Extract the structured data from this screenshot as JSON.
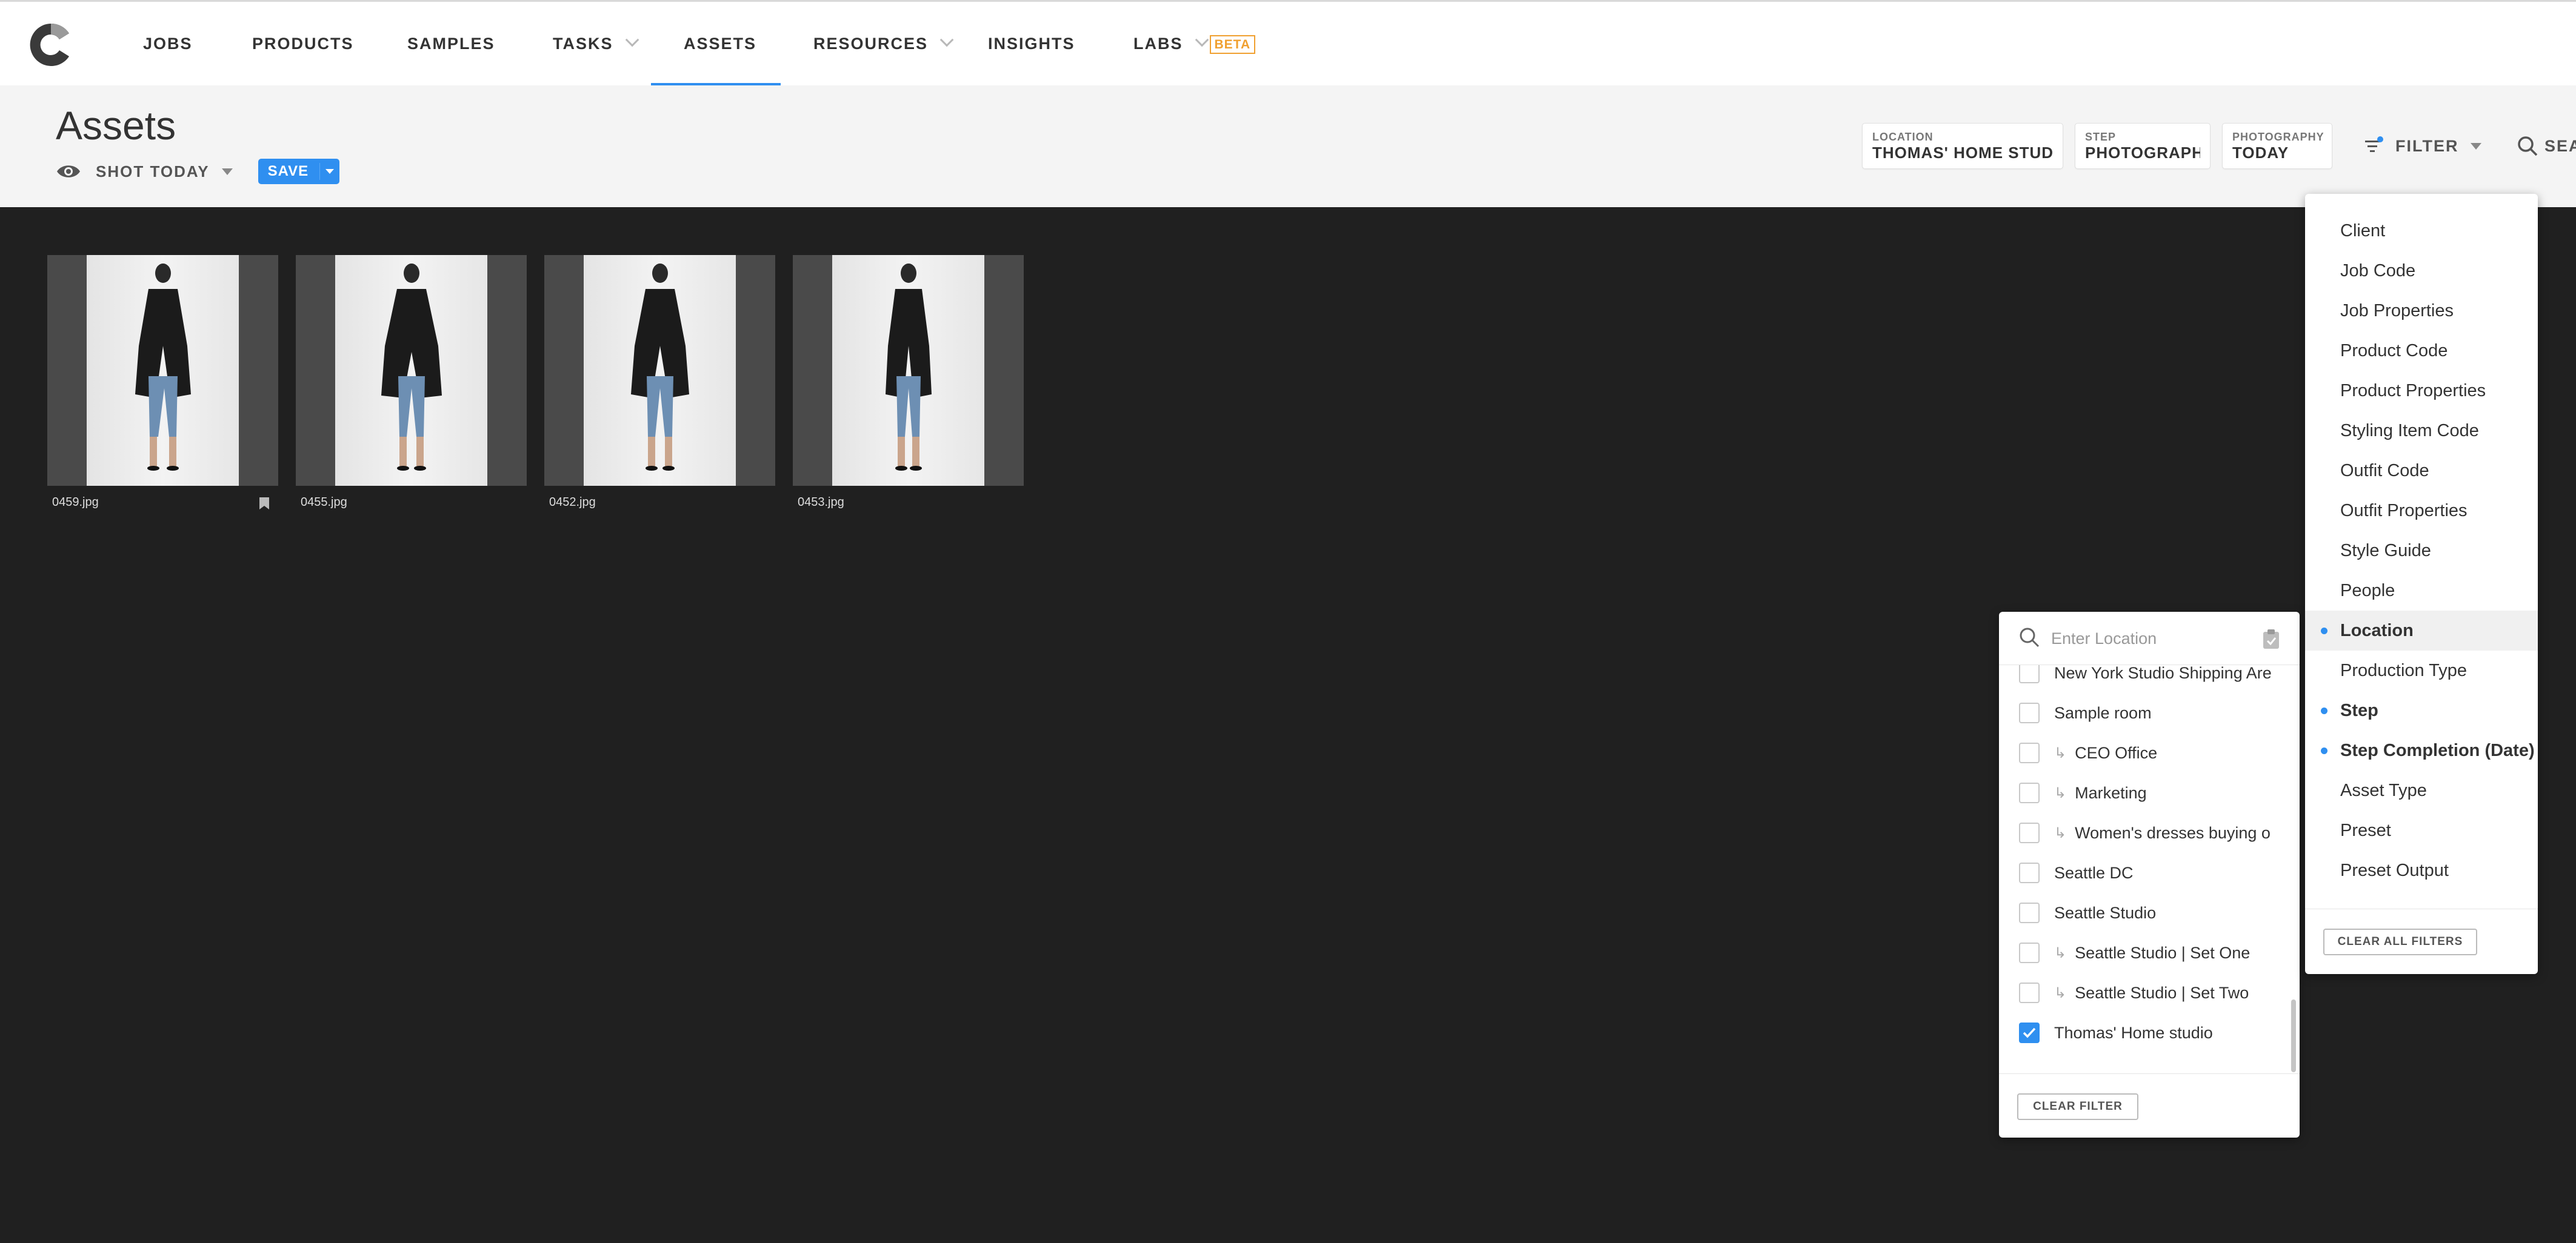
{
  "nav": {
    "items": [
      {
        "label": "JOBS",
        "dropdown": false,
        "active": false
      },
      {
        "label": "PRODUCTS",
        "dropdown": false,
        "active": false
      },
      {
        "label": "SAMPLES",
        "dropdown": false,
        "active": false
      },
      {
        "label": "TASKS",
        "dropdown": true,
        "active": false
      },
      {
        "label": "ASSETS",
        "dropdown": false,
        "active": true
      },
      {
        "label": "RESOURCES",
        "dropdown": true,
        "active": false
      },
      {
        "label": "INSIGHTS",
        "dropdown": false,
        "active": false
      },
      {
        "label": "LABS",
        "dropdown": true,
        "active": false
      }
    ],
    "beta_badge": "BETA"
  },
  "header": {
    "title": "Assets",
    "view_label": "SHOT TODAY",
    "save_label": "SAVE",
    "pills": [
      {
        "key": "LOCATION",
        "value": "THOMAS' HOME STUDI..."
      },
      {
        "key": "STEP",
        "value": "PHOTOGRAPHY"
      },
      {
        "key": "PHOTOGRAPHY",
        "value": "TODAY"
      }
    ],
    "filter_label": "FILTER",
    "search_label": "SEA"
  },
  "assets": [
    {
      "filename": "0459.jpg",
      "bookmarked": true
    },
    {
      "filename": "0455.jpg",
      "bookmarked": false
    },
    {
      "filename": "0452.jpg",
      "bookmarked": false
    },
    {
      "filename": "0453.jpg",
      "bookmarked": false
    }
  ],
  "filter_menu": {
    "items": [
      {
        "label": "Client",
        "active": false
      },
      {
        "label": "Job Code",
        "active": false
      },
      {
        "label": "Job Properties",
        "active": false
      },
      {
        "label": "Product Code",
        "active": false
      },
      {
        "label": "Product Properties",
        "active": false
      },
      {
        "label": "Styling Item Code",
        "active": false
      },
      {
        "label": "Outfit Code",
        "active": false
      },
      {
        "label": "Outfit Properties",
        "active": false
      },
      {
        "label": "Style Guide",
        "active": false
      },
      {
        "label": "People",
        "active": false
      },
      {
        "label": "Location",
        "active": true,
        "highlighted": true
      },
      {
        "label": "Production Type",
        "active": false
      },
      {
        "label": "Step",
        "active": true
      },
      {
        "label": "Step Completion (Date)",
        "active": true
      },
      {
        "label": "Asset Type",
        "active": false
      },
      {
        "label": "Preset",
        "active": false
      },
      {
        "label": "Preset Output",
        "active": false
      }
    ],
    "clear_all_label": "CLEAR ALL FILTERS"
  },
  "location_filter": {
    "placeholder": "Enter Location",
    "options": [
      {
        "label": "New York Studio Shipping Are",
        "child": false,
        "checked": false
      },
      {
        "label": "Sample room",
        "child": false,
        "checked": false
      },
      {
        "label": "CEO Office",
        "child": true,
        "checked": false
      },
      {
        "label": "Marketing",
        "child": true,
        "checked": false
      },
      {
        "label": "Women's dresses buying o",
        "child": true,
        "checked": false
      },
      {
        "label": "Seattle DC",
        "child": false,
        "checked": false
      },
      {
        "label": "Seattle Studio",
        "child": false,
        "checked": false
      },
      {
        "label": "Seattle Studio | Set One",
        "child": true,
        "checked": false
      },
      {
        "label": "Seattle Studio | Set Two",
        "child": true,
        "checked": false
      },
      {
        "label": "Thomas' Home studio",
        "child": false,
        "checked": true
      }
    ],
    "clear_label": "CLEAR FILTER"
  },
  "colors": {
    "accent": "#2f8ff0",
    "beta": "#f0a030",
    "background": "#202020",
    "header": "#f4f4f4"
  },
  "icons": [
    "logo-icon",
    "eye-icon",
    "filter-icon",
    "search-icon",
    "bookmark-icon",
    "clipboard-icon",
    "checkmark-icon",
    "subitem-arrow-icon"
  ]
}
